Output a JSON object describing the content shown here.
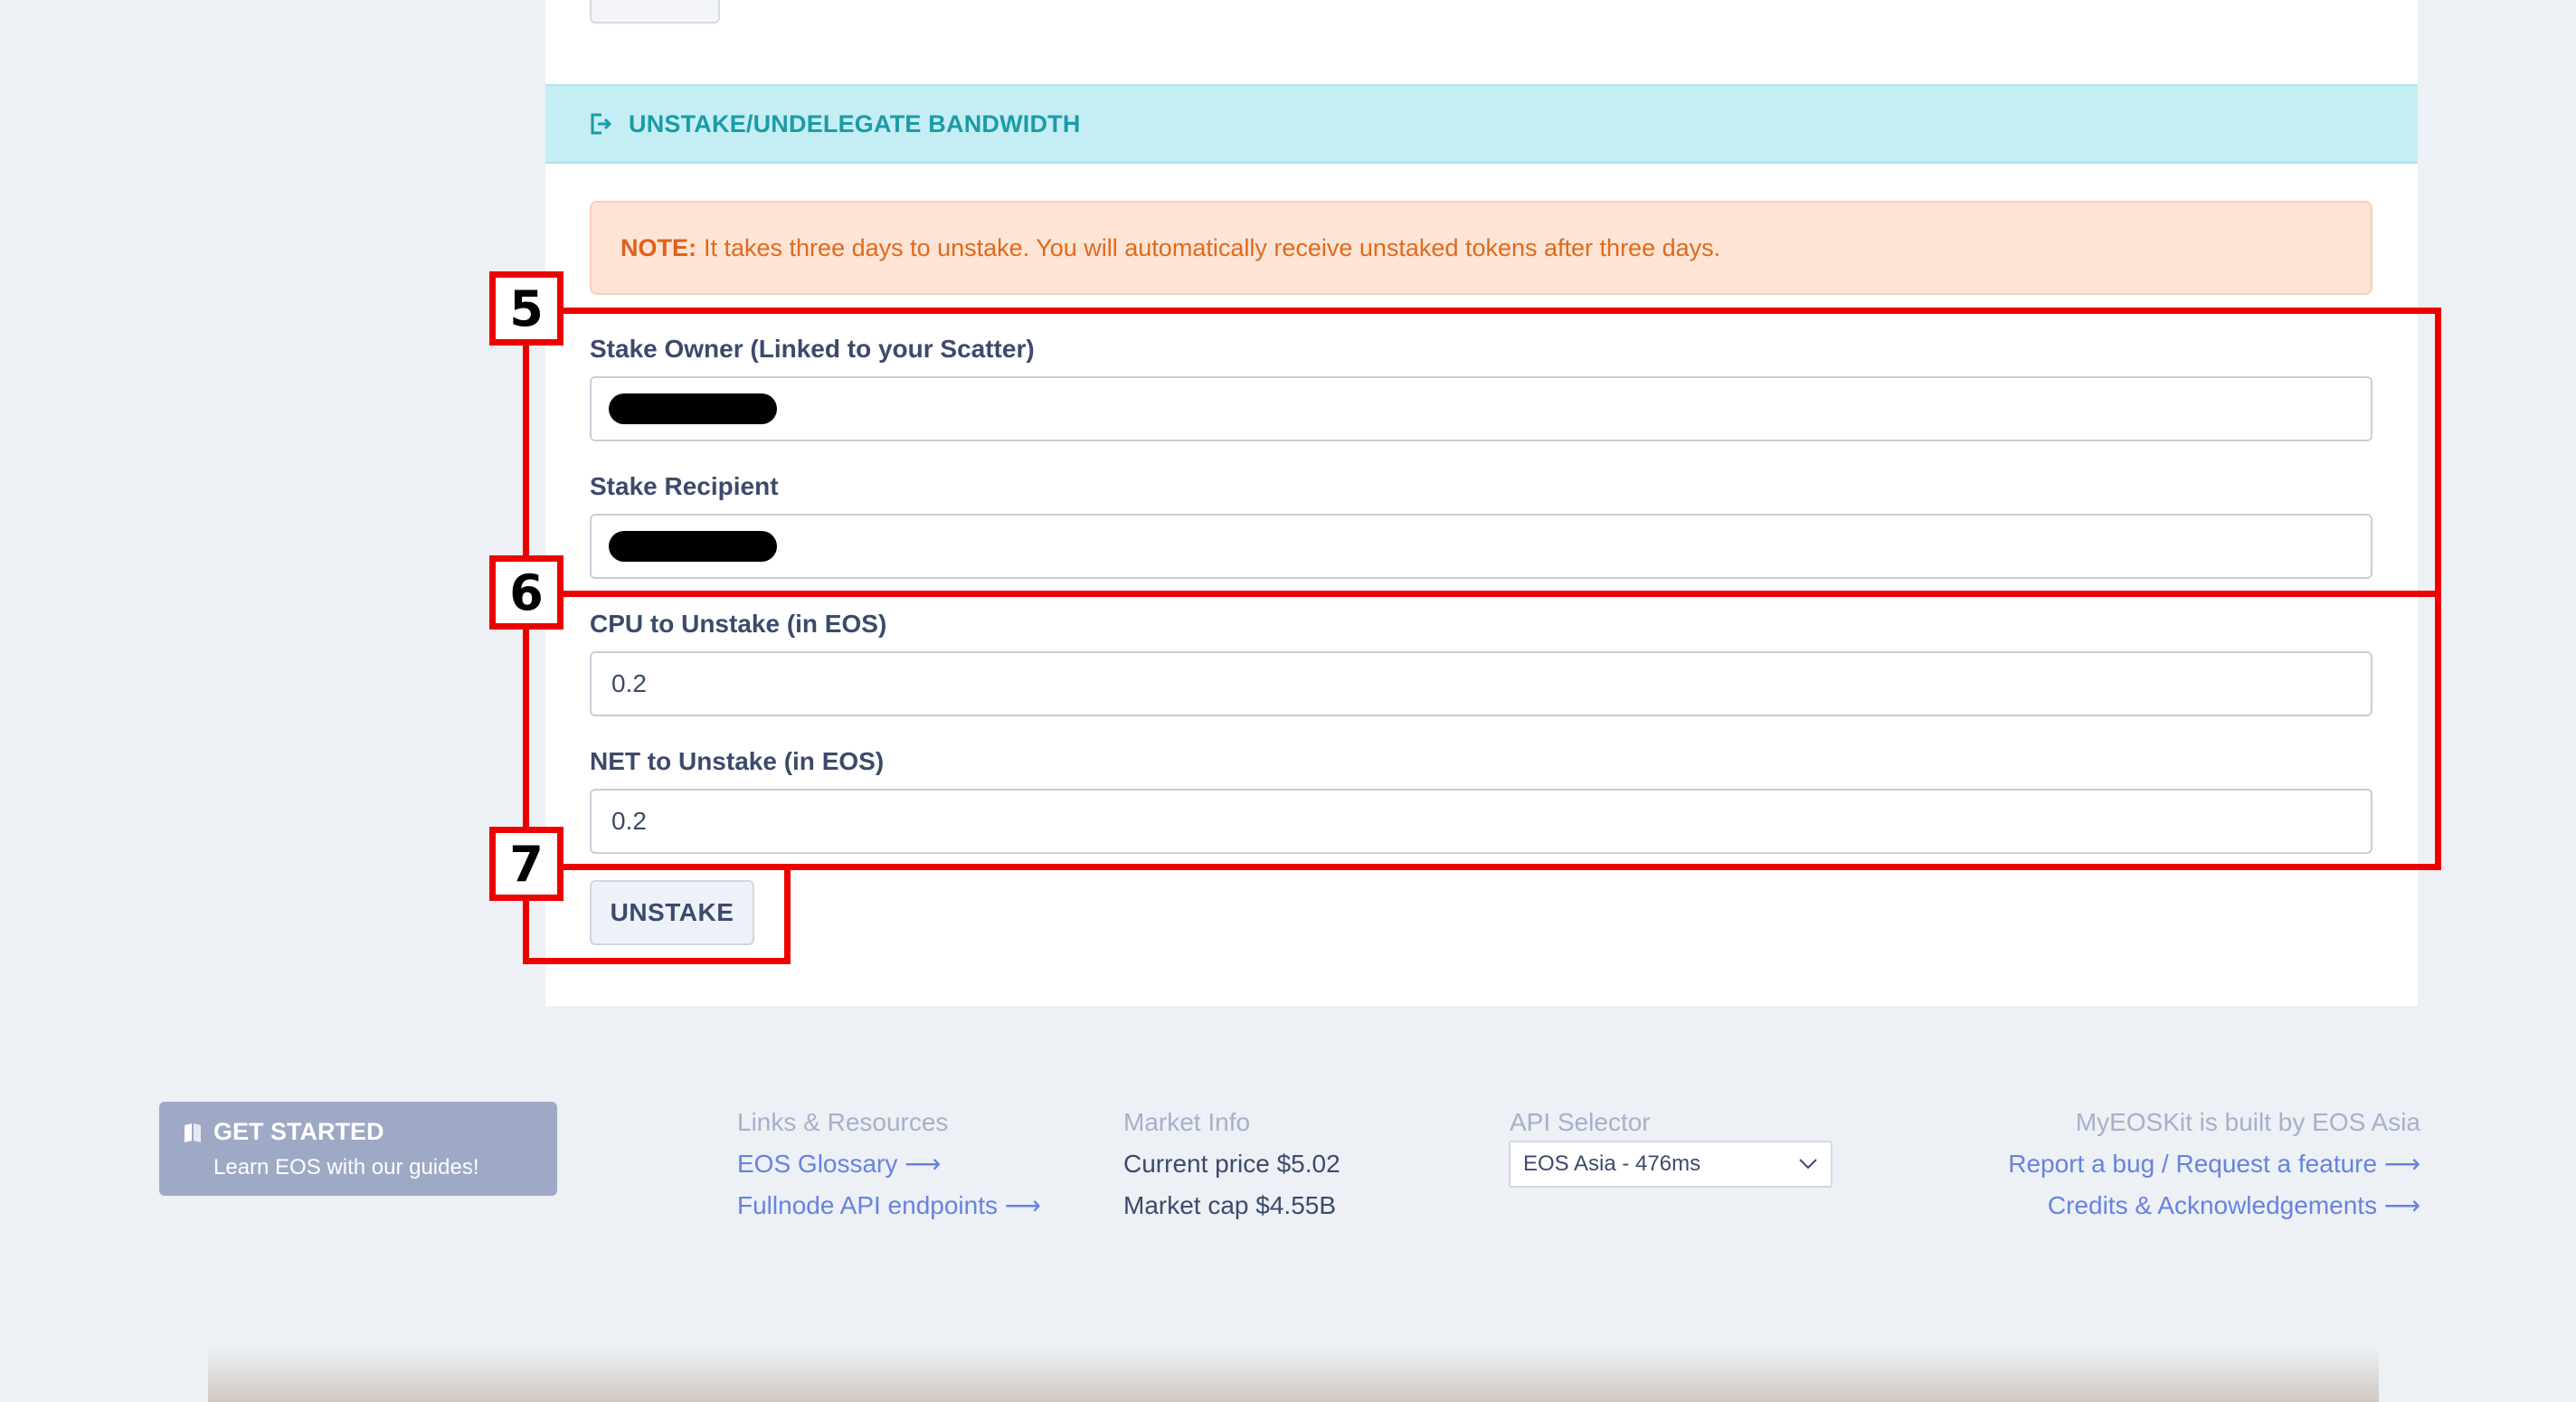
{
  "section": {
    "title": "UNSTAKE/UNDELEGATE BANDWIDTH"
  },
  "note": {
    "label": "NOTE:",
    "text": "It takes three days to unstake. You will automatically receive unstaked tokens after three days."
  },
  "form": {
    "owner_label": "Stake Owner (Linked to your Scatter)",
    "recipient_label": "Stake Recipient",
    "cpu_label": "CPU to Unstake (in EOS)",
    "cpu_value": "0.2",
    "net_label": "NET to Unstake (in EOS)",
    "net_value": "0.2",
    "submit_label": "UNSTAKE"
  },
  "annotations": [
    "5",
    "6",
    "7"
  ],
  "footer": {
    "get_started_title": "GET STARTED",
    "get_started_sub": "Learn EOS with our guides!",
    "links_heading": "Links & Resources",
    "link_glossary": "EOS Glossary ⟶",
    "link_fullnode": "Fullnode API endpoints ⟶",
    "market_heading": "Market Info",
    "current_price": "Current price $5.02",
    "market_cap": "Market cap $4.55B",
    "api_heading": "API Selector",
    "api_selected": "EOS Asia - 476ms",
    "built_by": "MyEOSKit is built by EOS Asia",
    "report_link": "Report a bug / Request a feature ⟶",
    "credits_link": "Credits & Acknowledgements ⟶"
  },
  "colors": {
    "header_bg": "#c4eef4",
    "header_text": "#1a9ca6",
    "note_bg": "#fde4d5",
    "note_text": "#e06a1a",
    "annotation_red": "#ee0000",
    "link": "#6683e0"
  },
  "icons": {
    "header_icon": "sign-out-icon",
    "get_started_icon": "book-icon",
    "select_icon": "chevron-down-icon"
  }
}
